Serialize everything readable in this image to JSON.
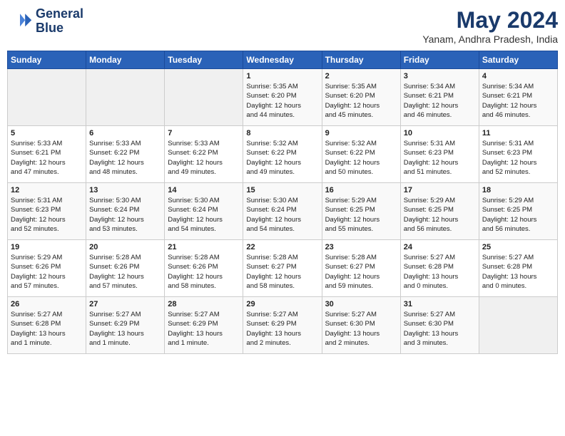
{
  "logo": {
    "line1": "General",
    "line2": "Blue"
  },
  "title": "May 2024",
  "location": "Yanam, Andhra Pradesh, India",
  "days_header": [
    "Sunday",
    "Monday",
    "Tuesday",
    "Wednesday",
    "Thursday",
    "Friday",
    "Saturday"
  ],
  "weeks": [
    [
      {
        "day": "",
        "info": ""
      },
      {
        "day": "",
        "info": ""
      },
      {
        "day": "",
        "info": ""
      },
      {
        "day": "1",
        "info": "Sunrise: 5:35 AM\nSunset: 6:20 PM\nDaylight: 12 hours\nand 44 minutes."
      },
      {
        "day": "2",
        "info": "Sunrise: 5:35 AM\nSunset: 6:20 PM\nDaylight: 12 hours\nand 45 minutes."
      },
      {
        "day": "3",
        "info": "Sunrise: 5:34 AM\nSunset: 6:21 PM\nDaylight: 12 hours\nand 46 minutes."
      },
      {
        "day": "4",
        "info": "Sunrise: 5:34 AM\nSunset: 6:21 PM\nDaylight: 12 hours\nand 46 minutes."
      }
    ],
    [
      {
        "day": "5",
        "info": "Sunrise: 5:33 AM\nSunset: 6:21 PM\nDaylight: 12 hours\nand 47 minutes."
      },
      {
        "day": "6",
        "info": "Sunrise: 5:33 AM\nSunset: 6:22 PM\nDaylight: 12 hours\nand 48 minutes."
      },
      {
        "day": "7",
        "info": "Sunrise: 5:33 AM\nSunset: 6:22 PM\nDaylight: 12 hours\nand 49 minutes."
      },
      {
        "day": "8",
        "info": "Sunrise: 5:32 AM\nSunset: 6:22 PM\nDaylight: 12 hours\nand 49 minutes."
      },
      {
        "day": "9",
        "info": "Sunrise: 5:32 AM\nSunset: 6:22 PM\nDaylight: 12 hours\nand 50 minutes."
      },
      {
        "day": "10",
        "info": "Sunrise: 5:31 AM\nSunset: 6:23 PM\nDaylight: 12 hours\nand 51 minutes."
      },
      {
        "day": "11",
        "info": "Sunrise: 5:31 AM\nSunset: 6:23 PM\nDaylight: 12 hours\nand 52 minutes."
      }
    ],
    [
      {
        "day": "12",
        "info": "Sunrise: 5:31 AM\nSunset: 6:23 PM\nDaylight: 12 hours\nand 52 minutes."
      },
      {
        "day": "13",
        "info": "Sunrise: 5:30 AM\nSunset: 6:24 PM\nDaylight: 12 hours\nand 53 minutes."
      },
      {
        "day": "14",
        "info": "Sunrise: 5:30 AM\nSunset: 6:24 PM\nDaylight: 12 hours\nand 54 minutes."
      },
      {
        "day": "15",
        "info": "Sunrise: 5:30 AM\nSunset: 6:24 PM\nDaylight: 12 hours\nand 54 minutes."
      },
      {
        "day": "16",
        "info": "Sunrise: 5:29 AM\nSunset: 6:25 PM\nDaylight: 12 hours\nand 55 minutes."
      },
      {
        "day": "17",
        "info": "Sunrise: 5:29 AM\nSunset: 6:25 PM\nDaylight: 12 hours\nand 56 minutes."
      },
      {
        "day": "18",
        "info": "Sunrise: 5:29 AM\nSunset: 6:25 PM\nDaylight: 12 hours\nand 56 minutes."
      }
    ],
    [
      {
        "day": "19",
        "info": "Sunrise: 5:29 AM\nSunset: 6:26 PM\nDaylight: 12 hours\nand 57 minutes."
      },
      {
        "day": "20",
        "info": "Sunrise: 5:28 AM\nSunset: 6:26 PM\nDaylight: 12 hours\nand 57 minutes."
      },
      {
        "day": "21",
        "info": "Sunrise: 5:28 AM\nSunset: 6:26 PM\nDaylight: 12 hours\nand 58 minutes."
      },
      {
        "day": "22",
        "info": "Sunrise: 5:28 AM\nSunset: 6:27 PM\nDaylight: 12 hours\nand 58 minutes."
      },
      {
        "day": "23",
        "info": "Sunrise: 5:28 AM\nSunset: 6:27 PM\nDaylight: 12 hours\nand 59 minutes."
      },
      {
        "day": "24",
        "info": "Sunrise: 5:27 AM\nSunset: 6:28 PM\nDaylight: 13 hours\nand 0 minutes."
      },
      {
        "day": "25",
        "info": "Sunrise: 5:27 AM\nSunset: 6:28 PM\nDaylight: 13 hours\nand 0 minutes."
      }
    ],
    [
      {
        "day": "26",
        "info": "Sunrise: 5:27 AM\nSunset: 6:28 PM\nDaylight: 13 hours\nand 1 minute."
      },
      {
        "day": "27",
        "info": "Sunrise: 5:27 AM\nSunset: 6:29 PM\nDaylight: 13 hours\nand 1 minute."
      },
      {
        "day": "28",
        "info": "Sunrise: 5:27 AM\nSunset: 6:29 PM\nDaylight: 13 hours\nand 1 minute."
      },
      {
        "day": "29",
        "info": "Sunrise: 5:27 AM\nSunset: 6:29 PM\nDaylight: 13 hours\nand 2 minutes."
      },
      {
        "day": "30",
        "info": "Sunrise: 5:27 AM\nSunset: 6:30 PM\nDaylight: 13 hours\nand 2 minutes."
      },
      {
        "day": "31",
        "info": "Sunrise: 5:27 AM\nSunset: 6:30 PM\nDaylight: 13 hours\nand 3 minutes."
      },
      {
        "day": "",
        "info": ""
      }
    ]
  ]
}
